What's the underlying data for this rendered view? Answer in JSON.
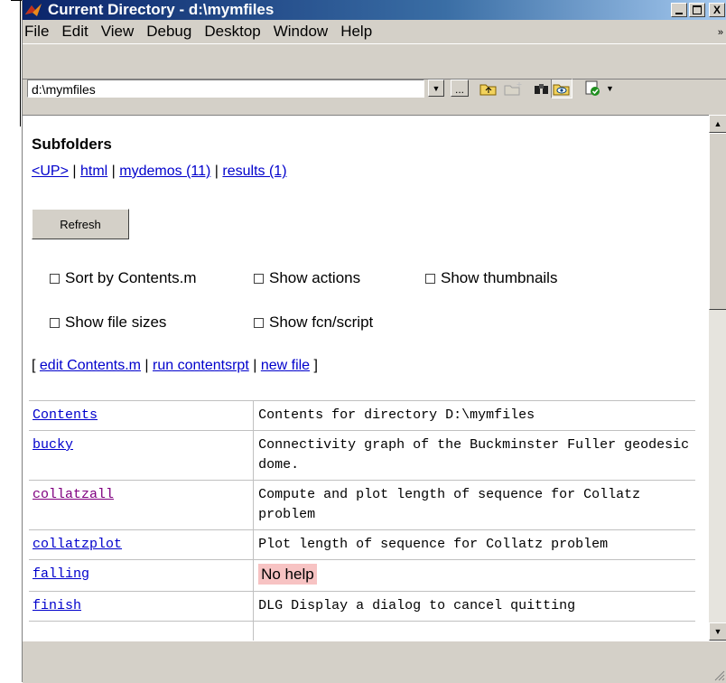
{
  "window": {
    "title": "Current Directory - d:\\mymfiles",
    "minimize_icon": "minimize-icon",
    "maximize_icon": "maximize-icon",
    "close_label": "X"
  },
  "menu": {
    "items": [
      "File",
      "Edit",
      "View",
      "Debug",
      "Desktop",
      "Window",
      "Help"
    ],
    "overflow_icon": "double-chevron-icon"
  },
  "toolbar": {
    "path_value": "d:\\mymfiles",
    "browse_label": "...",
    "icons": [
      "up-folder-icon",
      "new-folder-icon",
      "find-icon",
      "view-options-icon",
      "run-check-icon"
    ]
  },
  "subfolders": {
    "title": "Subfolders",
    "links": [
      "<UP>",
      "html",
      "mydemos (11)",
      "results (1)"
    ]
  },
  "refresh": {
    "label": "Refresh"
  },
  "options": {
    "sort": "Sort by Contents.m",
    "actions": "Show actions",
    "thumbnails": "Show thumbnails",
    "sizes": "Show file sizes",
    "fcnscript": "Show fcn/script"
  },
  "actions": {
    "open": "[",
    "edit": "edit Contents.m",
    "run": "run contentsrpt",
    "newfile": "new file",
    "close": "]"
  },
  "files": [
    {
      "name": "Contents",
      "desc": "Contents for directory D:\\mymfiles"
    },
    {
      "name": "bucky",
      "desc": "Connectivity graph of the Buckminster Fuller geodesic dome."
    },
    {
      "name": "collatzall",
      "desc": "Compute and plot length of sequence for Collatz problem"
    },
    {
      "name": "collatzplot",
      "desc": "Plot length of sequence for Collatz problem"
    },
    {
      "name": "falling",
      "desc": "No help"
    },
    {
      "name": "finish",
      "desc": "DLG Display a dialog to cancel quitting"
    }
  ],
  "colors": {
    "link": "#0000cc",
    "visited_link": "#800080",
    "no_help_bg": "#f7c3c3",
    "titlebar": "#0a246a"
  }
}
